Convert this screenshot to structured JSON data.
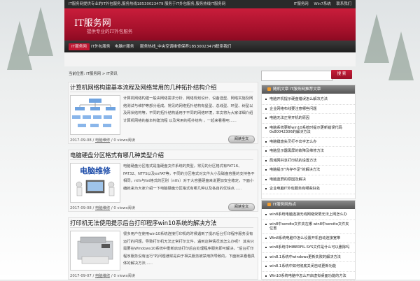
{
  "header": {
    "notice": "IT服务网提供专业的IT外包服务,服务热线18530023479 服务于IT外包服务,服务热线IT服务网",
    "links": [
      "IT服务网",
      "Win7系统",
      "联系我们"
    ],
    "site_title": "IT服务网",
    "site_subtitle": "提供专业的IT外包服务"
  },
  "nav": {
    "items": [
      {
        "label": "IT服务网",
        "active": true
      },
      {
        "label": "IT外包服务",
        "active": false
      },
      {
        "label": "电脑IT服务",
        "active": false
      },
      {
        "label": "服务热线_中央空调维修保养18530023479",
        "active": false
      },
      {
        "label": "联系我们",
        "active": false
      }
    ]
  },
  "breadcrumb": "当前位置: IT服务网 > IT资讯",
  "search": {
    "placeholder": "",
    "button": "搜 索"
  },
  "posts": [
    {
      "title": "计算机网络构建基本流程及网络常用的几种拓扑结构介绍",
      "excerpt": "计算机网络构建一般由网络需求分析、网络规划设计、设备选型、网络实施及网络测试与维护等部分组成，常见的网络拓扑结构有星型、总线型、环型、树型以及网状结构等，不同的拓扑结构适用于不同的网络环境，本文将为大家详细介绍计算机网络的基本构建流程 以及常用的拓扑结构 ，一起来看看吧......",
      "date": "2017-09-08",
      "category": "电脑维修",
      "views": "0 views阅读",
      "more": "阅读全文",
      "thumb": "network-diagram"
    },
    {
      "title": "电脑硬盘分区格式有哪几种类型介绍",
      "excerpt": "电脑硬盘分区格式是指硬盘文件系统的类型，常见的分区格式有FAT16、FAT32、NTFS以及exFAT等，不同的分区格式对文件大小及磁盘容量的支持各不相同，ntfs与fat格式的区别（ntfs）对于大容量硬盘来说更加安全稳定，下面小编就来为大家介绍一下电脑硬盘分区格式有哪几种以及各自的优缺点......",
      "date": "2017-09-08",
      "category": "电脑维修",
      "views": "0 views阅读",
      "more": "阅读全文",
      "thumb": "电脑维修"
    },
    {
      "title": "打印机无法使用提示后台打印程序win10系统的解决方法",
      "excerpt": "很多用户在使用win10系统连接打印机的时候遇到了提示后台打印程序服务没有运行的问题，导致打印机无法正常打印文件，遇到这种情况该怎么办呢？ 其实只需要在Windows10系统中重新启动打印后台处理程序服务即可解决，\"后台打印程序服务没有运行\"的问题通常是由于相关服务被禁用所导致的，下面就来看看具体的解决方法......",
      "date": "2017-09-07",
      "category": "电脑维修",
      "views": "0 views阅读",
      "more": "阅读全文",
      "thumb": "printer"
    }
  ],
  "widgets": [
    {
      "title": "随机文章 IT服务网推荐文章",
      "items": [
        "电脑开机提示硬盘错误怎么解决方法",
        "企业网络布线要注意哪些问题",
        "电脑无法正常开机的原因",
        "电脑系统更新win10系统时提示更新错误代码0x80042306的解决方法",
        "电脑键盘失灵打不出字怎么办",
        "电脑显示器黑屏的故障及维修方法",
        "局域网共享打印机的设置方法",
        "电脑提示\"内存不足\"的解决方法",
        "电脑蓝屏的原因及解决",
        "企业电脑IT外包服务有哪些好处"
      ]
    },
    {
      "title": "IT服务网热点",
      "items": [
        "win8系统电脑连接无线网络受限无法上网怎么办",
        "win8中sendto文件夹在哪 win8中sendto文件夹位置",
        "Win8系统电脑中怎么设置开机自动连接宽带",
        "win8系统中HIBERFIL.SYS文件是什么可以删除吗",
        "win8.1系统中windows更新失败的解决方法",
        "win8.1系统中如何彻底关闭自动更新功能",
        "Win10系统电脑中怎么开启虚拟桌面功能的方法"
      ]
    }
  ]
}
